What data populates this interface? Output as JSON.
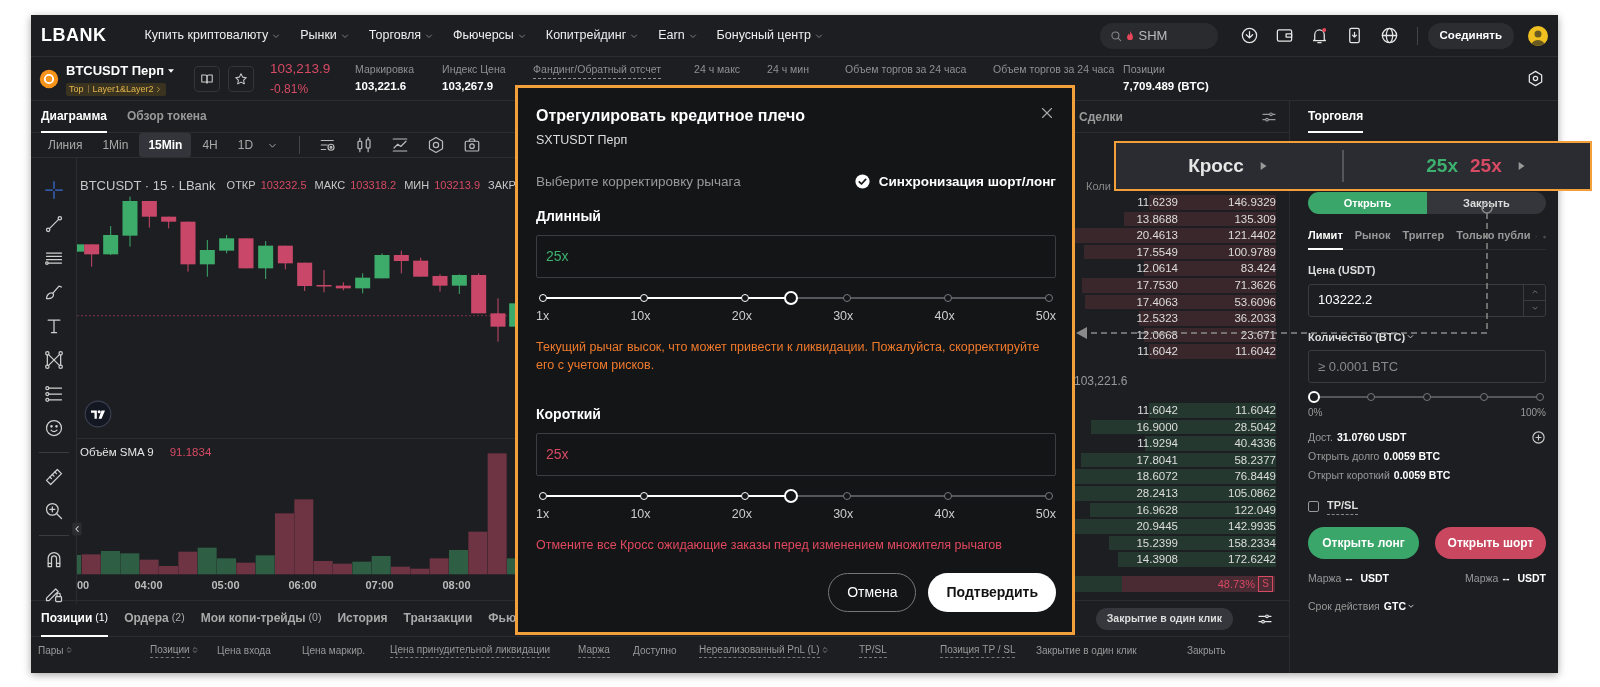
{
  "nav": {
    "logo": "LBANK",
    "items": [
      {
        "label": "Купить криптовалюту"
      },
      {
        "label": "Рынки"
      },
      {
        "label": "Торговля"
      },
      {
        "label": "Фьючерсы"
      },
      {
        "label": "Копитрейдинг"
      },
      {
        "label": "Earn"
      },
      {
        "label": "Бонусный центр"
      }
    ],
    "search": {
      "placeholder": "SHM"
    },
    "connect_button": "Соединять"
  },
  "ticker": {
    "symbol": "BTCUSDT Перп",
    "tags": [
      "Top",
      "Layer1&Layer2"
    ],
    "price": "103,213.9",
    "change": "-0.81%",
    "stats": [
      {
        "label": "Маркировка",
        "value": "103,221.6",
        "underlined": false
      },
      {
        "label": "Индекс Цена",
        "value": "103,267.9",
        "underlined": false
      },
      {
        "label": "Фандинг/Обратный отсчет",
        "underlined": true
      },
      {
        "label": "24 ч макс",
        "underlined": false
      },
      {
        "label": "24 ч мин",
        "underlined": false
      },
      {
        "label": "Объем торгов за 24 часа",
        "underlined": false
      },
      {
        "label": "Объем торгов за 24 часа",
        "underlined": false
      },
      {
        "label": "Позиции",
        "value": "7,709.489 (BTC)",
        "underlined": false
      }
    ]
  },
  "chart_panel": {
    "tabs": [
      {
        "label": "Диаграмма",
        "selected": true
      },
      {
        "label": "Обзор токена",
        "selected": false
      }
    ],
    "intervals": [
      {
        "label": "Линия",
        "selected": false
      },
      {
        "label": "1Min",
        "selected": false
      },
      {
        "label": "15Min",
        "selected": true
      },
      {
        "label": "4H",
        "selected": false
      },
      {
        "label": "1D",
        "selected": false
      }
    ],
    "legend": {
      "title": "BTCUSDT · 15 · LBank",
      "ohlc": [
        {
          "label": "ОТКР",
          "value": "103232.5"
        },
        {
          "label": "МАКС",
          "value": "103318.2"
        },
        {
          "label": "МИН",
          "value": "103213.9"
        },
        {
          "label": "ЗАКР"
        }
      ]
    },
    "volume": {
      "label": "Объём SMA 9",
      "value": "91.1834"
    },
    "time_labels": [
      "00",
      "04:00",
      "05:00",
      "06:00",
      "07:00",
      "08:00"
    ]
  },
  "order_book": {
    "tab": "Сделки",
    "column": "Коли",
    "asks": [
      {
        "amount": "11.6239",
        "total": "146.9329"
      },
      {
        "amount": "13.8688",
        "total": "135.309"
      },
      {
        "amount": "20.4613",
        "total": "121.4402"
      },
      {
        "amount": "17.5549",
        "total": "100.9789"
      },
      {
        "amount": "12.0614",
        "total": "83.424"
      },
      {
        "amount": "17.7530",
        "total": "71.3626"
      },
      {
        "amount": "17.4063",
        "total": "53.6096"
      },
      {
        "amount": "12.5323",
        "total": "36.2033"
      },
      {
        "amount": "12.0668",
        "total": "23.671"
      },
      {
        "amount": "11.6042",
        "total": "11.6042"
      }
    ],
    "mid_price": "103,221.6",
    "bids": [
      {
        "amount": "11.6042",
        "total": "11.6042"
      },
      {
        "amount": "16.9000",
        "total": "28.5042"
      },
      {
        "amount": "11.9294",
        "total": "40.4336"
      },
      {
        "amount": "17.8041",
        "total": "58.2377"
      },
      {
        "amount": "18.6072",
        "total": "76.8449"
      },
      {
        "amount": "28.2413",
        "total": "105.0862"
      },
      {
        "amount": "16.9628",
        "total": "122.049"
      },
      {
        "amount": "20.9445",
        "total": "142.9935"
      },
      {
        "amount": "15.2399",
        "total": "158.2334"
      },
      {
        "amount": "14.3908",
        "total": "172.6242"
      }
    ],
    "ratio": {
      "sell": "48.73%",
      "label": "S",
      "level": 0.7
    }
  },
  "trade_panel": {
    "tab": "Торговля",
    "sides": [
      {
        "label": "Открыть",
        "selected": true
      },
      {
        "label": "Закрыть",
        "selected": false
      }
    ],
    "order_types": [
      {
        "label": "Лимит",
        "selected": true
      },
      {
        "label": "Рынок",
        "selected": false
      },
      {
        "label": "Триггер",
        "selected": false
      },
      {
        "label": "Только публи",
        "selected": false
      }
    ],
    "price": {
      "label": "Цена (USDT)",
      "value": "103222.2"
    },
    "quantity": {
      "label": "Количество (BTC)",
      "placeholder": "≥ 0.0001 BTC"
    },
    "slider": {
      "level": 0,
      "min_label": "0%",
      "max_label": "100%"
    },
    "info": [
      {
        "label": "Дост.",
        "value": "31.0760 USDT"
      },
      {
        "label": "Открыть долго",
        "value": "0.0059 BTC"
      },
      {
        "label": "Открыт короткий",
        "value": "0.0059 BTC"
      }
    ],
    "tpsl": {
      "label": "TP/SL",
      "checked": false
    },
    "buttons": [
      {
        "label": "Открыть лонг",
        "kind": "long"
      },
      {
        "label": "Открыть шорт",
        "kind": "short"
      }
    ],
    "margins": [
      {
        "label": "Маржа",
        "value": "--",
        "unit": "USDT"
      },
      {
        "label": "Маржа",
        "value": "--",
        "unit": "USDT"
      }
    ],
    "validity": {
      "label": "Срок действия",
      "value": "GTC"
    }
  },
  "positions": {
    "tabs": [
      {
        "label": "Позиции",
        "count": "(1)",
        "selected": true
      },
      {
        "label": "Ордера",
        "count": "(2)",
        "selected": false
      },
      {
        "label": "Мои копи-трейды",
        "count": "(0)",
        "selected": false
      },
      {
        "label": "История",
        "selected": false
      },
      {
        "label": "Транзакции",
        "selected": false
      },
      {
        "label": "Фью",
        "selected": false
      }
    ],
    "one_click_button": "Закрытие в один клик",
    "columns": [
      {
        "label": "Пары",
        "sortable": true,
        "underlined": false
      },
      {
        "label": "Позиции",
        "sortable": true,
        "underlined": true
      },
      {
        "label": "Цена входа",
        "sortable": false,
        "underlined": false
      },
      {
        "label": "Цена маркир.",
        "sortable": false,
        "underlined": false
      },
      {
        "label": "Цена принудительной ликвидации",
        "sortable": false,
        "underlined": true
      },
      {
        "label": "Маржа",
        "sortable": false,
        "underlined": true
      },
      {
        "label": "Доступно",
        "sortable": false,
        "underlined": false
      },
      {
        "label": "Нереализованный PnL (L)",
        "sortable": true,
        "underlined": true
      },
      {
        "label": "TP/SL",
        "sortable": false,
        "underlined": true
      },
      {
        "label": "Позиция TP / SL",
        "sortable": false,
        "underlined": true
      },
      {
        "label": "Закрытие в один клик",
        "sortable": false,
        "underlined": false
      },
      {
        "label": "Закрыть",
        "sortable": false,
        "underlined": false
      }
    ]
  },
  "modal": {
    "title": "Отрегулировать кредитное плечо",
    "subtitle": "SXTUSDT Перп",
    "prompt": "Выберите корректировку рычага",
    "sync": {
      "label": "Синхронизация шорт/лонг",
      "checked": true
    },
    "sides": [
      {
        "kind": "long",
        "label": "Длинный",
        "value": "25x",
        "level": 0.49,
        "marks": [
          "1x",
          "10x",
          "20x",
          "30x",
          "40x",
          "50x"
        ],
        "note": "Текущий рычаг высок, что может привести к ликвидации. Пожалуйста, скорректируйте его с учетом рисков."
      },
      {
        "kind": "short",
        "label": "Короткий",
        "value": "25x",
        "level": 0.49,
        "marks": [
          "1x",
          "10x",
          "20x",
          "30x",
          "40x",
          "50x"
        ],
        "note": "Отмените все Кросс ожидающие заказы перед изменением множителя рычагов"
      }
    ],
    "buttons": [
      {
        "label": "Отмена",
        "kind": "secondary"
      },
      {
        "label": "Подтвердить",
        "kind": "primary"
      }
    ]
  },
  "callout": {
    "mode": "Кросс",
    "long": "25x",
    "short": "25x"
  }
}
